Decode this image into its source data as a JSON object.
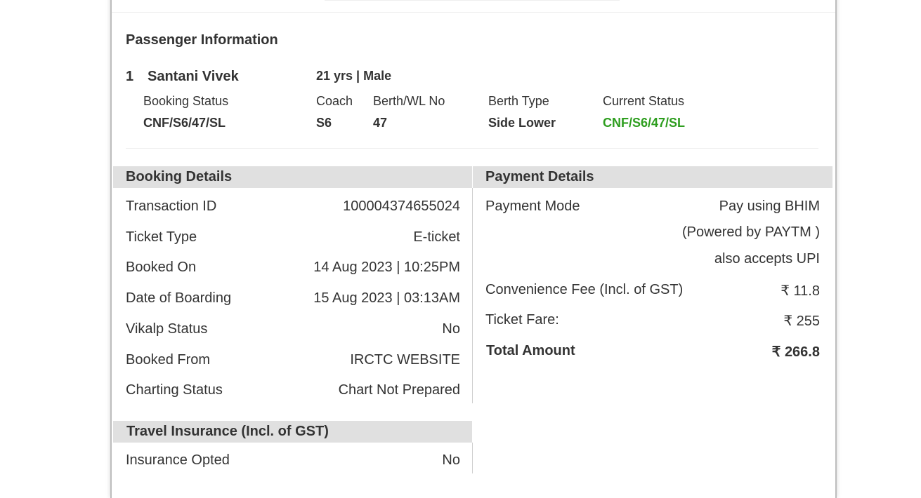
{
  "passenger": {
    "section_title": "Passenger Information",
    "number": "1",
    "name": "Santani Vivek",
    "age_gender": "21 yrs | Male",
    "booking_status_label": "Booking Status",
    "booking_status": "CNF/S6/47/SL",
    "coach_label": "Coach",
    "coach": "S6",
    "berth_label": "Berth/WL No",
    "berth": "47",
    "berth_type_label": "Berth Type",
    "berth_type": "Side Lower",
    "current_status_label": "Current Status",
    "current_status": "CNF/S6/47/SL",
    "current_status_color": "#2e9e1f"
  },
  "booking": {
    "title": "Booking Details",
    "rows": [
      {
        "label": "Transaction ID",
        "value": "100004374655024"
      },
      {
        "label": "Ticket Type",
        "value": "E-ticket"
      },
      {
        "label": "Booked On",
        "value": "14 Aug 2023 | 10:25PM"
      },
      {
        "label": "Date of Boarding",
        "value": "15 Aug 2023 | 03:13AM"
      },
      {
        "label": "Vikalp Status",
        "value": "No"
      },
      {
        "label": "Booked From",
        "value": "IRCTC WEBSITE"
      },
      {
        "label": "Charting Status",
        "value": "Chart Not Prepared"
      }
    ]
  },
  "payment": {
    "title": "Payment Details",
    "mode_label": "Payment Mode",
    "mode_line1": "Pay using BHIM",
    "mode_line2": "(Powered by PAYTM )",
    "mode_line3": "also accepts UPI",
    "fee_label": "Convenience Fee (Incl. of GST)",
    "fee_value": "₹ 11.8",
    "fare_label": "Ticket Fare:",
    "fare_value": "₹ 255",
    "total_label": "Total Amount",
    "total_value": "₹ 266.8"
  },
  "insurance": {
    "title": "Travel Insurance (Incl. of GST)",
    "opted_label": "Insurance Opted",
    "opted_value": "No"
  }
}
